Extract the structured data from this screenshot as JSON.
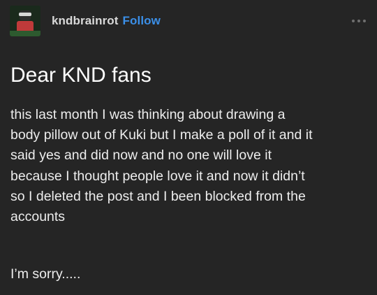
{
  "post": {
    "author": {
      "username": "kndbrainrot",
      "follow_label": "Follow",
      "avatar_icon": "avatar-image"
    },
    "more_icon": "more-options-icon",
    "title": "Dear KND fans",
    "body_lines": [
      "this last month I was thinking about drawing a",
      "body pillow out of Kuki but I make a poll of it and it",
      "said yes and did now and no one will love it",
      "because I thought people love it and now it didn’t",
      "so I deleted the post and I been blocked from the",
      "accounts"
    ],
    "closing": "I’m sorry.....",
    "colors": {
      "background": "#252525",
      "follow": "#3b8fe8",
      "text": "#ffffff"
    }
  }
}
